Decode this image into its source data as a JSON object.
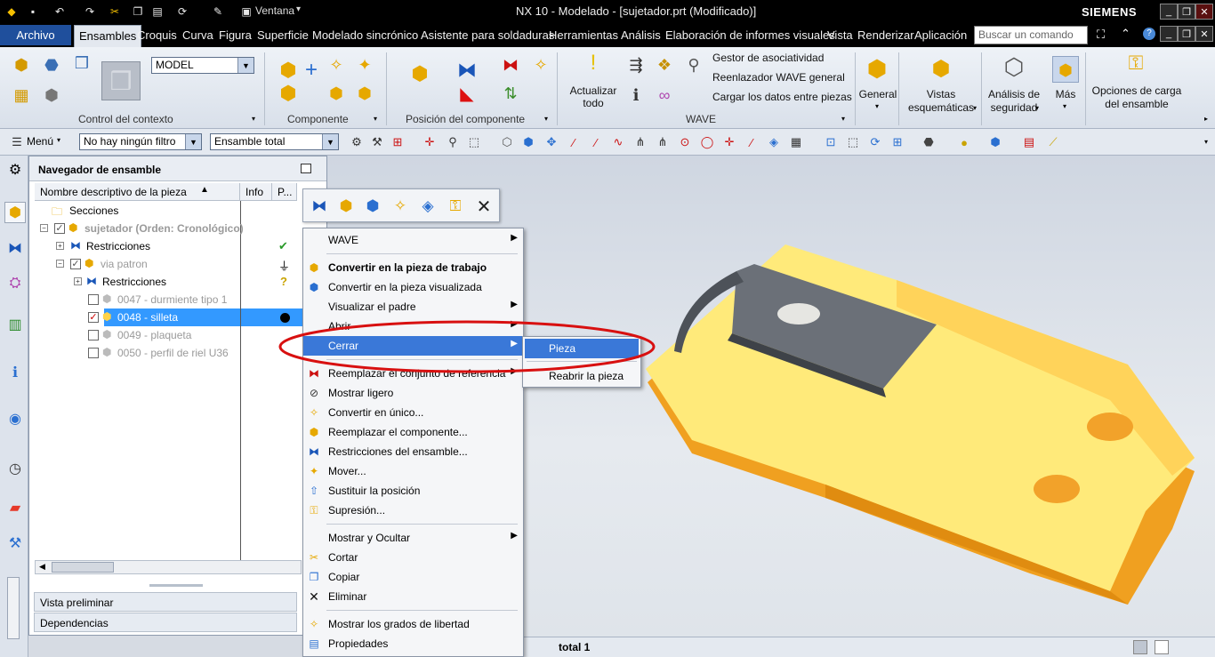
{
  "title_bar": {
    "window_menu": "Ventana",
    "title": "NX 10 - Modelado - [sujetador.prt (Modificado)]",
    "brand": "SIEMENS"
  },
  "tabs": {
    "archivo": "Archivo",
    "items": [
      "Ensambles",
      "Croquis",
      "Curva",
      "Figura",
      "Superficie",
      "Modelado sincrónico",
      "Asistente para soldaduras",
      "Herramientas",
      "Análisis",
      "Elaboración de informes visuales",
      "Vista",
      "Renderizar",
      "Aplicación"
    ],
    "search_placeholder": "Buscar un comando"
  },
  "ribbon": {
    "model_value": "MODEL",
    "groups": {
      "context": "Control del contexto",
      "component": "Componente",
      "position": "Posición del componente",
      "wave": "WAVE"
    },
    "wave_links": [
      "Gestor de asociatividad",
      "Reenlazador WAVE general",
      "Cargar los datos entre piezas"
    ],
    "actualizar": "Actualizar todo",
    "general": "General",
    "vistas": "Vistas esquemáticas",
    "analisis": "Análisis de seguridad",
    "mas": "Más",
    "opciones": "Opciones de carga del ensamble"
  },
  "toolbar": {
    "menu": "Menú",
    "filter": "No hay ningún filtro",
    "scope": "Ensamble total"
  },
  "navigator": {
    "title": "Navegador de ensamble",
    "columns": [
      "Nombre descriptivo de la pieza",
      "Info",
      "P..."
    ],
    "rows": [
      {
        "label": "Secciones"
      },
      {
        "label": "sujetador (Orden: Cronológico)"
      },
      {
        "label": "Restricciones"
      },
      {
        "label": "via patron"
      },
      {
        "label": "Restricciones"
      },
      {
        "label": "0047 - durmiente tipo 1"
      },
      {
        "label": "0048 - silleta"
      },
      {
        "label": "0049 - plaqueta"
      },
      {
        "label": "0050 - perfil de riel U36"
      }
    ],
    "bottom": [
      "Vista preliminar",
      "Dependencias"
    ]
  },
  "context_menu": {
    "items": [
      {
        "label": "WAVE"
      },
      {
        "label": "Convertir en la pieza de trabajo"
      },
      {
        "label": "Convertir en la pieza visualizada"
      },
      {
        "label": "Visualizar el padre"
      },
      {
        "label": "Abrir"
      },
      {
        "label": "Cerrar"
      },
      {
        "label": "Reemplazar el conjunto de referencia"
      },
      {
        "label": "Mostrar ligero"
      },
      {
        "label": "Convertir en único..."
      },
      {
        "label": "Reemplazar el componente..."
      },
      {
        "label": "Restricciones del ensamble..."
      },
      {
        "label": "Mover..."
      },
      {
        "label": "Sustituir la posición"
      },
      {
        "label": "Supresión..."
      },
      {
        "label": "Mostrar y Ocultar"
      },
      {
        "label": "Cortar"
      },
      {
        "label": "Copiar"
      },
      {
        "label": "Eliminar"
      },
      {
        "label": "Mostrar los grados de libertad"
      },
      {
        "label": "Propiedades"
      }
    ]
  },
  "submenu": {
    "items": [
      "Pieza",
      "Reabrir la pieza"
    ]
  },
  "status": {
    "text": "total 1"
  }
}
